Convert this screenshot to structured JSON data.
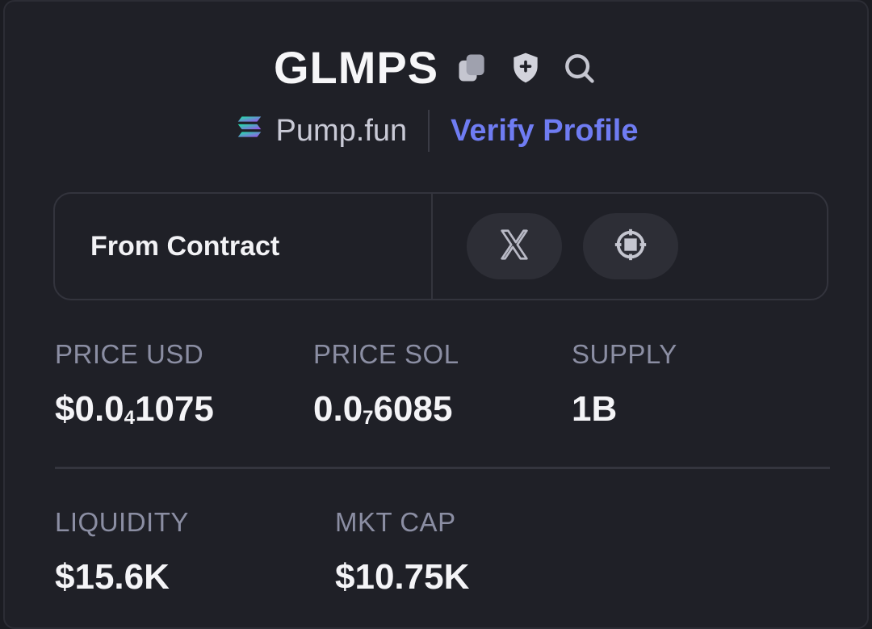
{
  "token": {
    "name": "GLMPS",
    "platform": "Pump.fun",
    "verify_label": "Verify Profile"
  },
  "contract": {
    "label": "From Contract"
  },
  "stats": {
    "price_usd": {
      "label": "PRICE USD",
      "prefix": "$0.0",
      "zeros": "4",
      "digits": "1075"
    },
    "price_sol": {
      "label": "PRICE SOL",
      "prefix": "0.0",
      "zeros": "7",
      "digits": "6085"
    },
    "supply": {
      "label": "SUPPLY",
      "value": "1B"
    },
    "liquidity": {
      "label": "LIQUIDITY",
      "value": "$15.6K"
    },
    "mkt_cap": {
      "label": "MKT CAP",
      "value": "$10.75K"
    }
  },
  "colors": {
    "background": "#1f2027",
    "accent": "#6f7cf2",
    "label": "#8b8ea3"
  },
  "icons": [
    "copy-icon",
    "shield-icon",
    "search-icon",
    "solana-icon",
    "x-icon",
    "website-icon"
  ]
}
